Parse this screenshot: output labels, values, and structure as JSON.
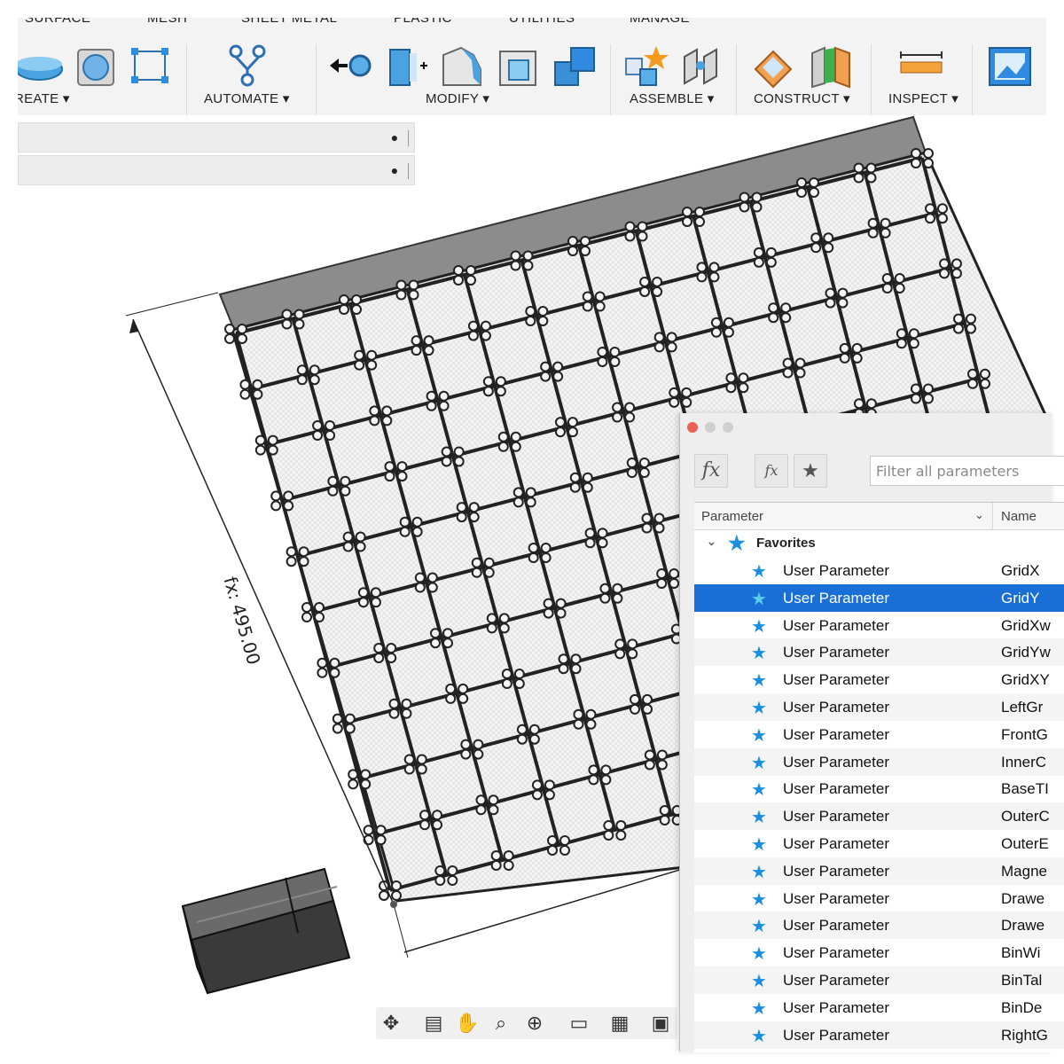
{
  "toolbar": {
    "tabs": [
      "SURFACE",
      "MESH",
      "SHEET METAL",
      "PLASTIC",
      "UTILITIES",
      "MANAGE"
    ],
    "menus": [
      "REATE ▾",
      "AUTOMATE ▾",
      "MODIFY ▾",
      "ASSEMBLE ▾",
      "CONSTRUCT ▾",
      "INSPECT ▾"
    ]
  },
  "browser_panel": {
    "rows": [
      "●",
      "●"
    ]
  },
  "viewport": {
    "dimension_label": "fx: 495.00"
  },
  "navigation_bar": {
    "icons": [
      "move-icon",
      "look-icon",
      "pan-icon",
      "zoom-icon",
      "fit-icon",
      "display-icon",
      "grid-icon",
      "viewports-icon"
    ]
  },
  "parameters_dialog": {
    "fx_button": "fx",
    "user_param_button": "fx",
    "favorites_button": "★",
    "filter_placeholder": "Filter all parameters",
    "columns": {
      "parameter": "Parameter",
      "name": "Name"
    },
    "favorites_label": "Favorites",
    "rows": [
      {
        "type": "User Parameter",
        "name": "GridX"
      },
      {
        "type": "User Parameter",
        "name": "GridY"
      },
      {
        "type": "User Parameter",
        "name": "GridXw"
      },
      {
        "type": "User Parameter",
        "name": "GridYw"
      },
      {
        "type": "User Parameter",
        "name": "GridXY"
      },
      {
        "type": "User Parameter",
        "name": "LeftGr"
      },
      {
        "type": "User Parameter",
        "name": "FrontG"
      },
      {
        "type": "User Parameter",
        "name": "InnerC"
      },
      {
        "type": "User Parameter",
        "name": "BaseTI"
      },
      {
        "type": "User Parameter",
        "name": "OuterC"
      },
      {
        "type": "User Parameter",
        "name": "OuterE"
      },
      {
        "type": "User Parameter",
        "name": "Magne"
      },
      {
        "type": "User Parameter",
        "name": "Drawe"
      },
      {
        "type": "User Parameter",
        "name": "Drawe"
      },
      {
        "type": "User Parameter",
        "name": "BinWi"
      },
      {
        "type": "User Parameter",
        "name": "BinTal"
      },
      {
        "type": "User Parameter",
        "name": "BinDe"
      },
      {
        "type": "User Parameter",
        "name": "RightG"
      }
    ],
    "selected_index": 1
  },
  "colors": {
    "selection": "#1a6fd6",
    "star": "#1a8fe0"
  }
}
